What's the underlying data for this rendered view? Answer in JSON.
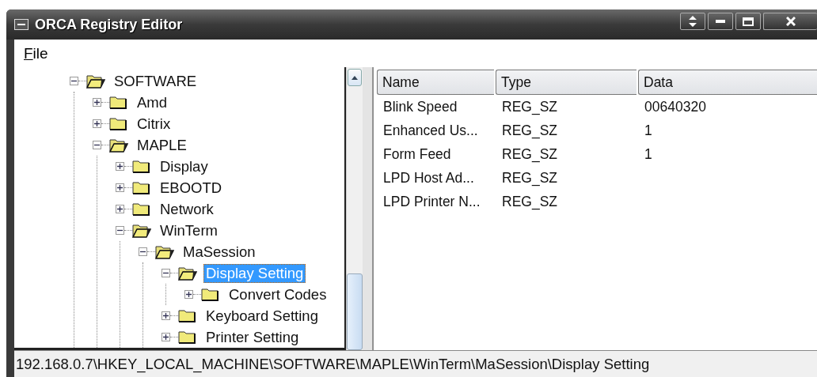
{
  "window": {
    "title": "ORCA Registry Editor"
  },
  "menu": [
    {
      "label": "File"
    }
  ],
  "tree": {
    "items": [
      {
        "label": "SOFTWARE",
        "expanded": true,
        "selected": false,
        "children": [
          {
            "label": "Amd",
            "expanded": false,
            "selected": false
          },
          {
            "label": "Citrix",
            "expanded": false,
            "selected": false
          },
          {
            "label": "MAPLE",
            "expanded": true,
            "selected": false,
            "children": [
              {
                "label": "Display",
                "expanded": false,
                "selected": false
              },
              {
                "label": "EBOOTD",
                "expanded": false,
                "selected": false
              },
              {
                "label": "Network",
                "expanded": false,
                "selected": false
              },
              {
                "label": "WinTerm",
                "expanded": true,
                "selected": false,
                "children": [
                  {
                    "label": "MaSession",
                    "expanded": true,
                    "selected": false,
                    "children": [
                      {
                        "label": "Display Setting",
                        "expanded": true,
                        "selected": true,
                        "children": [
                          {
                            "label": "Convert Codes",
                            "expanded": false,
                            "selected": false
                          }
                        ]
                      },
                      {
                        "label": "Keyboard Setting",
                        "expanded": false,
                        "selected": false
                      },
                      {
                        "label": "Printer Setting",
                        "expanded": false,
                        "selected": false
                      }
                    ]
                  }
                ]
              }
            ]
          }
        ]
      }
    ]
  },
  "table": {
    "columns": [
      "Name",
      "Type",
      "Data"
    ],
    "rows": [
      [
        "Blink Speed",
        "REG_SZ",
        "00640320"
      ],
      [
        "Enhanced Us...",
        "REG_SZ",
        "1"
      ],
      [
        "Form Feed",
        "REG_SZ",
        "1"
      ],
      [
        "LPD Host Ad...",
        "REG_SZ",
        ""
      ],
      [
        "LPD Printer N...",
        "REG_SZ",
        ""
      ]
    ]
  },
  "status_bar": "192.168.0.7\\HKEY_LOCAL_MACHINE\\SOFTWARE\\MAPLE\\WinTerm\\MaSession\\Display Setting"
}
